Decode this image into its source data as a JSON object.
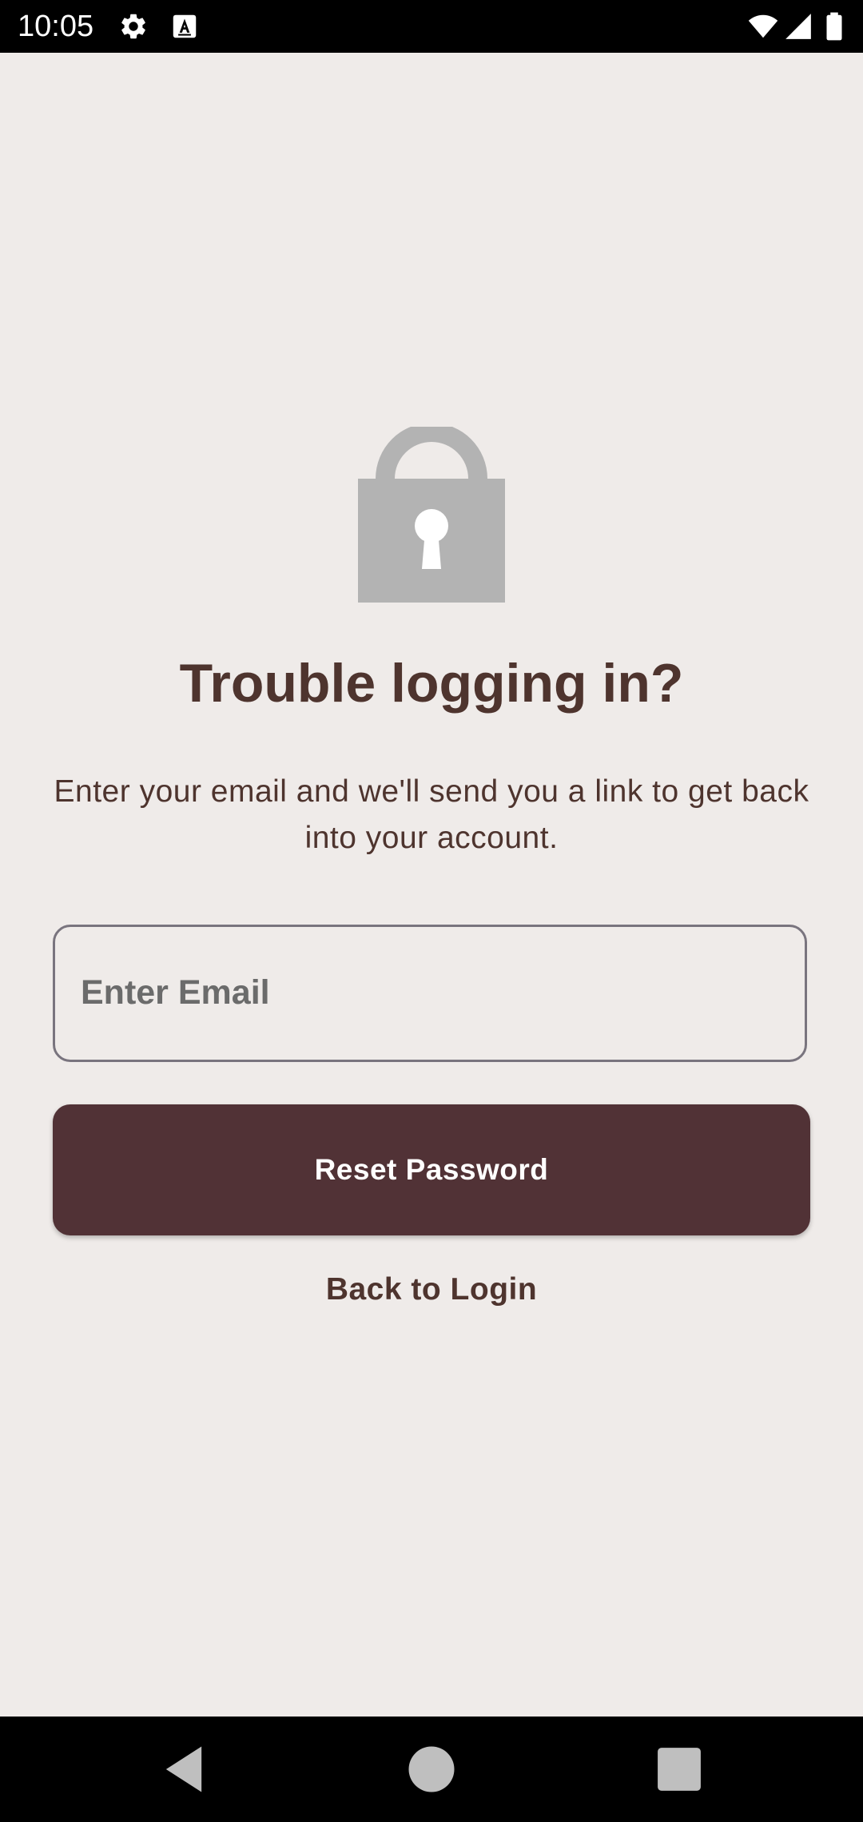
{
  "status_bar": {
    "time": "10:05",
    "icons": [
      "gear-icon",
      "keyboard-a-icon",
      "wifi-icon",
      "signal-icon",
      "battery-icon"
    ]
  },
  "screen": {
    "icon": "lock-icon",
    "title": "Trouble logging in?",
    "subtitle": "Enter your email and we'll send you a link to get back into your account.",
    "email_placeholder": "Enter Email",
    "reset_button": "Reset Password",
    "back_link": "Back to Login"
  },
  "nav_bar": {
    "buttons": [
      "back-icon",
      "home-icon",
      "recents-icon"
    ]
  },
  "colors": {
    "background": "#efebe9",
    "primary_text": "#4e342e",
    "button": "#513236",
    "lock_gray": "#b3b3b3"
  }
}
